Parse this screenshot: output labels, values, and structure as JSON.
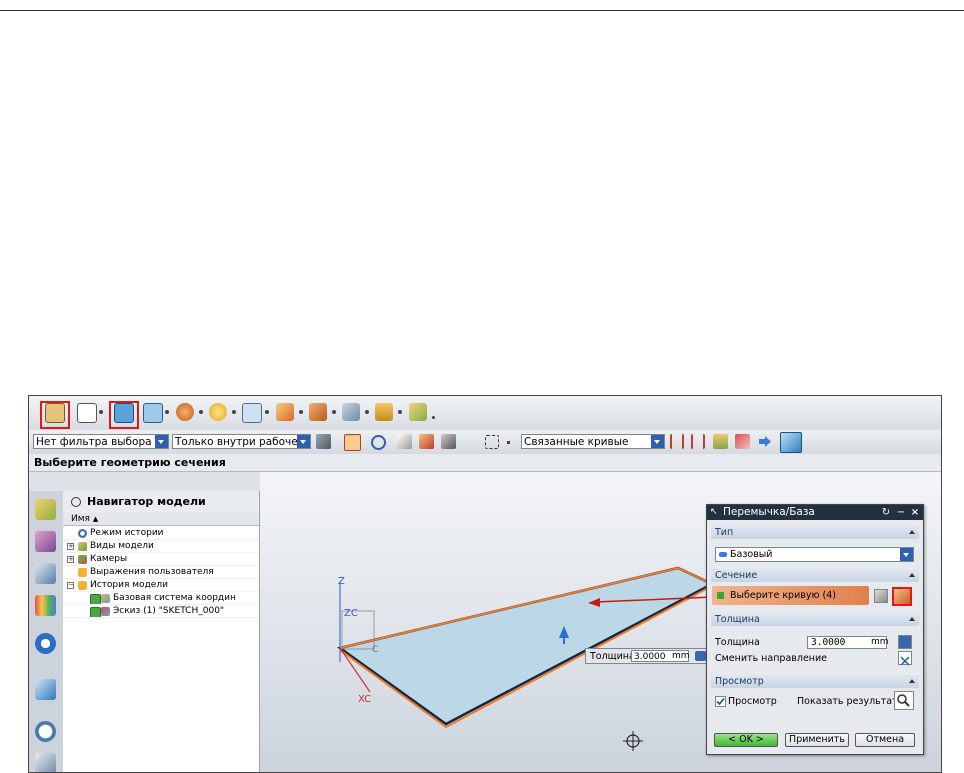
{
  "toolbar2": {
    "filter_select": "Нет фильтра выбора",
    "scope_select": "Только внутри рабочей д",
    "curve_rule_select": "Связанные кривые"
  },
  "status_bar": {
    "prompt": "Выберите геометрию сечения"
  },
  "navigator": {
    "title": "Навигатор модели",
    "column_name": "Имя",
    "items": [
      {
        "label": "Режим истории",
        "icon": "clock-icon"
      },
      {
        "label": "Виды модели",
        "icon": "views-icon"
      },
      {
        "label": "Камеры",
        "icon": "camera-icon"
      },
      {
        "label": "Выражения пользователя",
        "icon": "folder-icon"
      },
      {
        "label": "История модели",
        "icon": "folder-icon"
      },
      {
        "label": "Базовая система координ",
        "icon": "csys-icon"
      },
      {
        "label": "Эскиз (1) \"SKETCH_000\"",
        "icon": "sketch-icon"
      }
    ]
  },
  "viewport": {
    "axis_z": "Z",
    "axis_zc": "ZC",
    "axis_xc": "XC",
    "axis_yc": "C",
    "thickness_label": "Толщина",
    "thickness_value": "3.0000",
    "thickness_unit": "mm"
  },
  "dialog": {
    "title": "Перемычка/База",
    "sections": {
      "type": "Тип",
      "section": "Сечение",
      "thickness": "Толщина",
      "preview": "Просмотр"
    },
    "type_value": "Базовый",
    "select_curve": "Выберите кривую (4)",
    "thickness_label": "Толщина",
    "thickness_value": "3.0000",
    "thickness_unit": "mm",
    "reverse_direction": "Сменить направление",
    "preview_checkbox": "Просмотр",
    "preview_checked": true,
    "show_result": "Показать результат",
    "ok": "< OK >",
    "apply": "Применить",
    "cancel": "Отмена"
  },
  "colors": {
    "highlight_red": "#e01818",
    "part_edge_orange": "#f07a2a",
    "dialog_title": "#23303f",
    "ok_green": "#46b534"
  }
}
